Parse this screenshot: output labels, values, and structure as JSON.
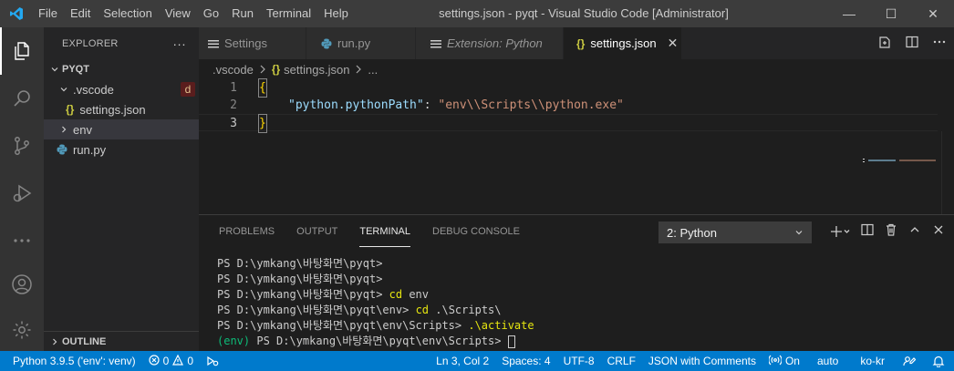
{
  "colors": {
    "accent": "#007acc",
    "folderIcon": "#519aba",
    "jsonIcon": "#cbcb41",
    "gitModified": "#e2c08d"
  },
  "window": {
    "title": "settings.json - pyqt - Visual Studio Code [Administrator]",
    "menu": [
      "File",
      "Edit",
      "Selection",
      "View",
      "Go",
      "Run",
      "Terminal",
      "Help"
    ],
    "controls": {
      "minimize": "—",
      "maximize": "☐",
      "close": "✕"
    }
  },
  "activity": [
    "explorer-icon",
    "search-icon",
    "source-control-icon",
    "run-debug-icon",
    "more-icon",
    "account-icon",
    "settings-gear-icon"
  ],
  "sidebar": {
    "title": "EXPLORER",
    "more": "···",
    "workspace": "PYQT",
    "tree": {
      "vscode": ".vscode",
      "vscode_badge": "d",
      "settings": "settings.json",
      "env": "env",
      "run": "run.py"
    },
    "outline": "OUTLINE"
  },
  "tabs": [
    {
      "label": "Settings"
    },
    {
      "label": "run.py"
    },
    {
      "label": "Extension: Python"
    },
    {
      "label": "settings.json",
      "close": "✕"
    }
  ],
  "breadcrumb": {
    "folder": ".vscode",
    "file": "settings.json",
    "rest": "..."
  },
  "code": {
    "line_numbers": [
      "1",
      "2",
      "3"
    ],
    "open_brace": "{",
    "key": "\"python.pythonPath\"",
    "colon": ": ",
    "value": "\"env\\\\Scripts\\\\python.exe\"",
    "close_brace": "}"
  },
  "panel": {
    "tabs": [
      "PROBLEMS",
      "OUTPUT",
      "TERMINAL",
      "DEBUG CONSOLE"
    ],
    "terminal_select": "2: Python",
    "actions": {
      "add": "+",
      "split": "split",
      "trash": "trash",
      "maximize": "^",
      "close": "✕"
    }
  },
  "terminal": {
    "lines": [
      {
        "prompt": "PS D:\\ymkang\\바탕화면\\pyqt>",
        "cmd": ""
      },
      {
        "prompt": "PS D:\\ymkang\\바탕화면\\pyqt>",
        "cmd": ""
      },
      {
        "prompt": "PS D:\\ymkang\\바탕화면\\pyqt> ",
        "cmd": "cd",
        "arg": " env"
      },
      {
        "prompt": "PS D:\\ymkang\\바탕화면\\pyqt\\env> ",
        "cmd": "cd",
        "arg": " .\\Scripts\\"
      },
      {
        "prompt": "PS D:\\ymkang\\바탕화면\\pyqt\\env\\Scripts> ",
        "cmd": ".\\activate",
        "arg": ""
      }
    ],
    "env_prefix": "(env)",
    "last_prompt": " PS D:\\ymkang\\바탕화면\\pyqt\\env\\Scripts> "
  },
  "status": {
    "python": "Python 3.9.5 ('env': venv)",
    "errors": "0",
    "warnings": "0",
    "position": "Ln 3, Col 2",
    "spaces": "Spaces: 4",
    "encoding": "UTF-8",
    "eol": "CRLF",
    "language": "JSON with Comments",
    "live": "On",
    "auto": "auto",
    "locale": "ko-kr"
  }
}
